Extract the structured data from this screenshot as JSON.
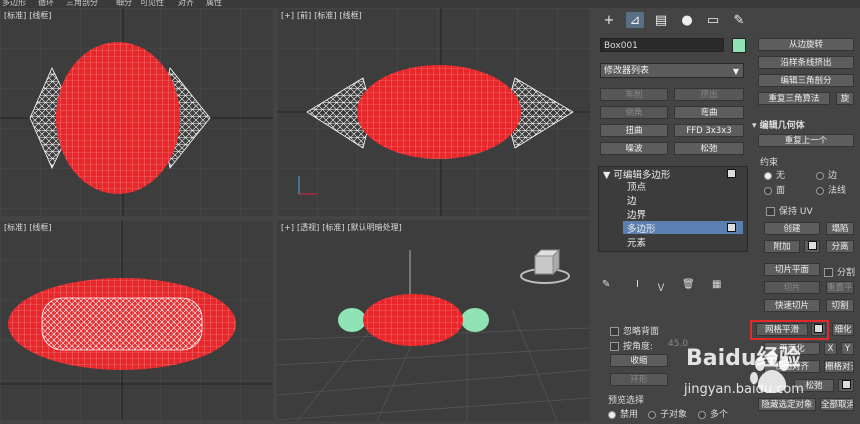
{
  "menubar": [
    "多边形",
    "循环",
    "三角剖分",
    "细分",
    "可见性",
    "对齐",
    "属性"
  ],
  "viewports": {
    "top": {
      "labels": [
        "[标准]",
        "[线框]"
      ]
    },
    "front": {
      "labels": [
        "[+]",
        "[前]",
        "[标准]",
        "[线框]"
      ]
    },
    "left": {
      "labels": [
        "[标准]",
        "[线框]"
      ]
    },
    "persp": {
      "labels": [
        "[+]",
        "[透视]",
        "[标准]",
        "[默认明暗处理]"
      ]
    }
  },
  "panel": {
    "object_name": "Box001",
    "object_color": "#8fe3b4",
    "modifier_list": "修改器列表",
    "modifier_buttons": [
      [
        "车削",
        "挤出"
      ],
      [
        "倒角",
        "弯曲"
      ],
      [
        "扭曲",
        "FFD 3x3x3"
      ],
      [
        "噪波",
        "松弛"
      ]
    ],
    "stack": {
      "root": "可编辑多边形",
      "items": [
        "顶点",
        "边",
        "边界",
        "多边形",
        "元素"
      ],
      "selected": "多边形"
    },
    "lower_left": {
      "ignore_backface": "忽略背面",
      "by_angle": "按角度:",
      "angle_value": "45.0",
      "shrink": "收缩",
      "ring": "环形",
      "preview_title": "预览选择",
      "preview_options": [
        "禁用",
        "子对象",
        "多个"
      ]
    },
    "right_column": {
      "top_buttons": [
        "从边旋转",
        "沿样条线挤出",
        "编辑三角剖分",
        "重复三角算法"
      ],
      "rotate_label": "旋",
      "rollout_title": "编辑几何体",
      "repeat_last": "重复上一个",
      "constraint_title": "约束",
      "constraints": [
        "无",
        "边",
        "面",
        "法线"
      ],
      "preserve_uv": "保持 UV",
      "create": "创建",
      "collapse": "塌陷",
      "attach": "附加",
      "detach": "分离",
      "slice_plane": "切片平面",
      "split": "分割",
      "slice": "切片",
      "reset_plane": "重置平面",
      "quick_slice": "快速切片",
      "cut": "切割",
      "meshsmooth": "网格平滑",
      "tessellate": "细化",
      "planarize": "平面化",
      "x": "X",
      "y": "Y",
      "view_align": "视图对齐",
      "grid_align": "栅格对齐",
      "relax": "松弛",
      "hide_selected": "隐藏选定对象",
      "unhide_all": "全部取消"
    }
  },
  "watermark": {
    "text": "Baidu经验",
    "url": "jingyan.baidu.com"
  }
}
